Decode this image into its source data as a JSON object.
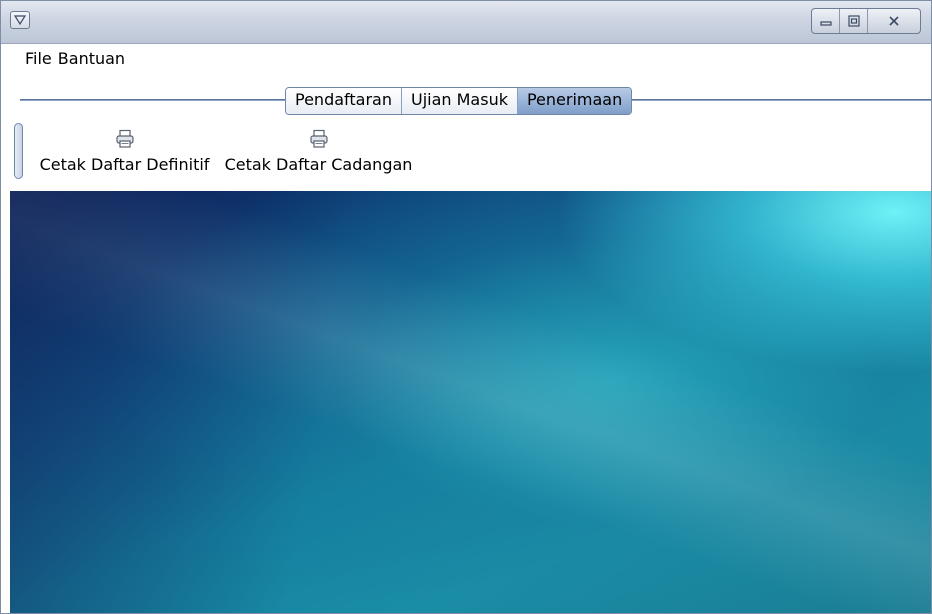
{
  "window": {
    "controls": {
      "system_menu_icon": "chevron-down-icon",
      "minimize_icon": "minimize-icon",
      "maximize_icon": "maximize-icon",
      "close_icon": "close-icon"
    }
  },
  "menubar": {
    "items": [
      "File",
      "Bantuan"
    ]
  },
  "tabs": {
    "items": [
      {
        "label": "Pendaftaran",
        "active": false
      },
      {
        "label": "Ujian Masuk",
        "active": false
      },
      {
        "label": "Penerimaan",
        "active": true
      }
    ]
  },
  "toolbar": {
    "buttons": [
      {
        "label": "Cetak Daftar Definitif",
        "icon": "printer-icon"
      },
      {
        "label": "Cetak Daftar Cadangan",
        "icon": "printer-icon"
      }
    ]
  },
  "colors": {
    "active_tab": "#9db6da",
    "titlebar": "#cdd5e2",
    "desktop_dark": "#0b1f5a",
    "desktop_light": "#6ff1f7"
  }
}
